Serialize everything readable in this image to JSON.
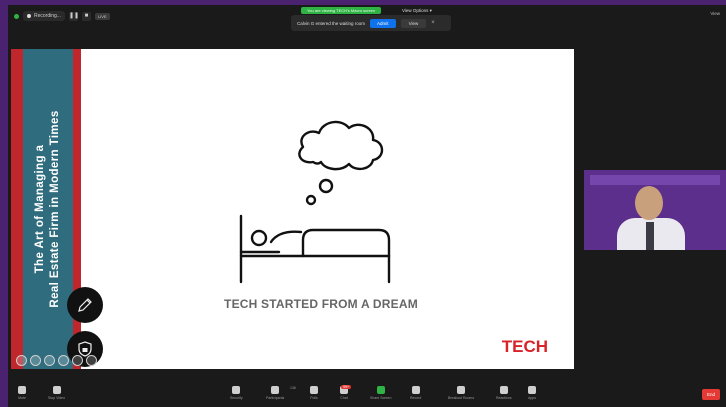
{
  "topbar": {
    "recording_label": "Recording...",
    "live_label": "LIVE",
    "banner_text": "You are viewing TECH's Macro screen",
    "view_options": "View Options ▾",
    "view_label": "View",
    "waiting_notice": "Calvin G entered the waiting room",
    "admit_label": "Admit",
    "see_label": "View"
  },
  "slide": {
    "title_line1": "The Art of Managing a",
    "title_line2": "Real Estate Firm in Modern Times",
    "caption": "TECH STARTED FROM A DREAM",
    "logo": "TECH"
  },
  "toolbar": {
    "mute": "Mute",
    "stop_video": "Stop Video",
    "security": "Security",
    "participants": "Participants",
    "participants_count": "136",
    "polls": "Polls",
    "chat": "Chat",
    "chat_badge": "99+",
    "share_screen": "Share Screen",
    "record": "Record",
    "breakout": "Breakout Rooms",
    "reactions": "Reactions",
    "apps": "Apps",
    "end": "End"
  },
  "colors": {
    "frame_purple": "#4a2270",
    "slide_red": "#c0272d",
    "slide_teal": "#2f6c7e",
    "logo_red": "#d8232a",
    "share_green": "#2fb344",
    "admit_blue": "#0e72ed"
  }
}
